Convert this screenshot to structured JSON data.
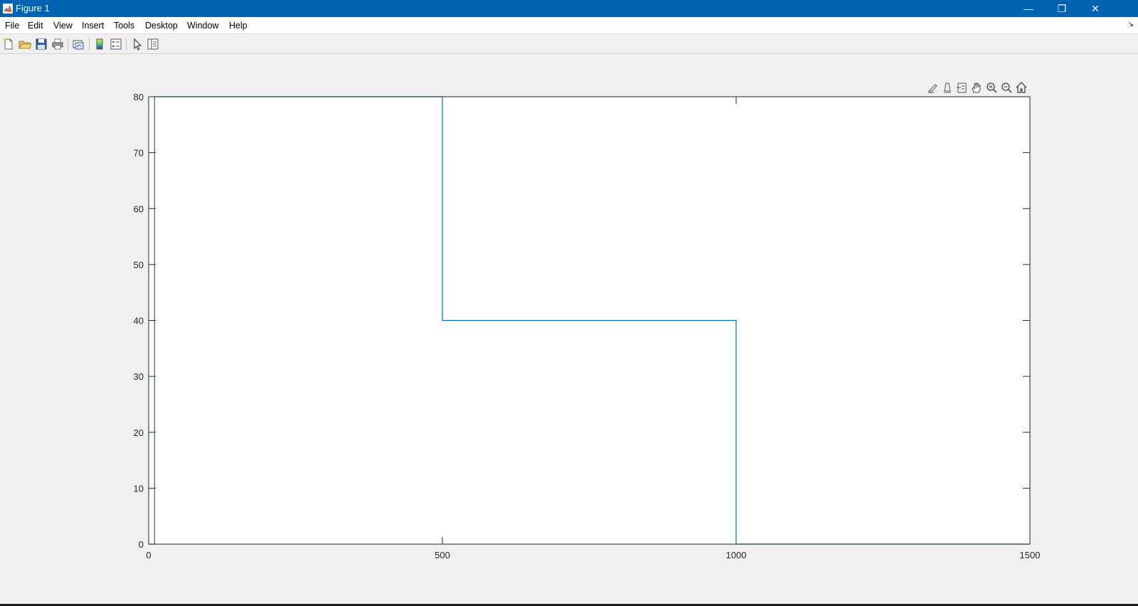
{
  "window": {
    "title": "Figure 1",
    "minimize_glyph": "—",
    "restore_glyph": "❐",
    "close_glyph": "✕"
  },
  "menu": {
    "items": [
      "File",
      "Edit",
      "View",
      "Insert",
      "Tools",
      "Desktop",
      "Window",
      "Help"
    ],
    "dock_glyph": "↘"
  },
  "toolbar": {
    "icons": [
      "new-figure-icon",
      "open-file-icon",
      "save-icon",
      "print-icon",
      "link-plot-icon",
      "colorbar-icon",
      "legend-icon",
      "edit-plot-pointer-icon",
      "property-inspector-icon"
    ]
  },
  "axes_toolbar": {
    "icons": [
      "brush-data-icon",
      "data-tips-icon",
      "restore-view-icon",
      "pan-icon",
      "zoom-in-icon",
      "zoom-out-icon",
      "home-icon"
    ]
  },
  "colors": {
    "titlebar": "#0063b1",
    "line": "#0072bd"
  },
  "chart_data": {
    "type": "line",
    "title": "",
    "xlabel": "",
    "ylabel": "",
    "xlim": [
      0,
      1500
    ],
    "ylim": [
      0,
      80
    ],
    "xticks": [
      0,
      500,
      1000,
      1500
    ],
    "yticks": [
      0,
      10,
      20,
      30,
      40,
      50,
      60,
      70,
      80
    ],
    "grid": false,
    "box": true,
    "series": [
      {
        "x": [
          0,
          10,
          10,
          500,
          500,
          1000,
          1000,
          1500
        ],
        "y": [
          0,
          0,
          80,
          80,
          40,
          40,
          0,
          0
        ]
      }
    ]
  }
}
